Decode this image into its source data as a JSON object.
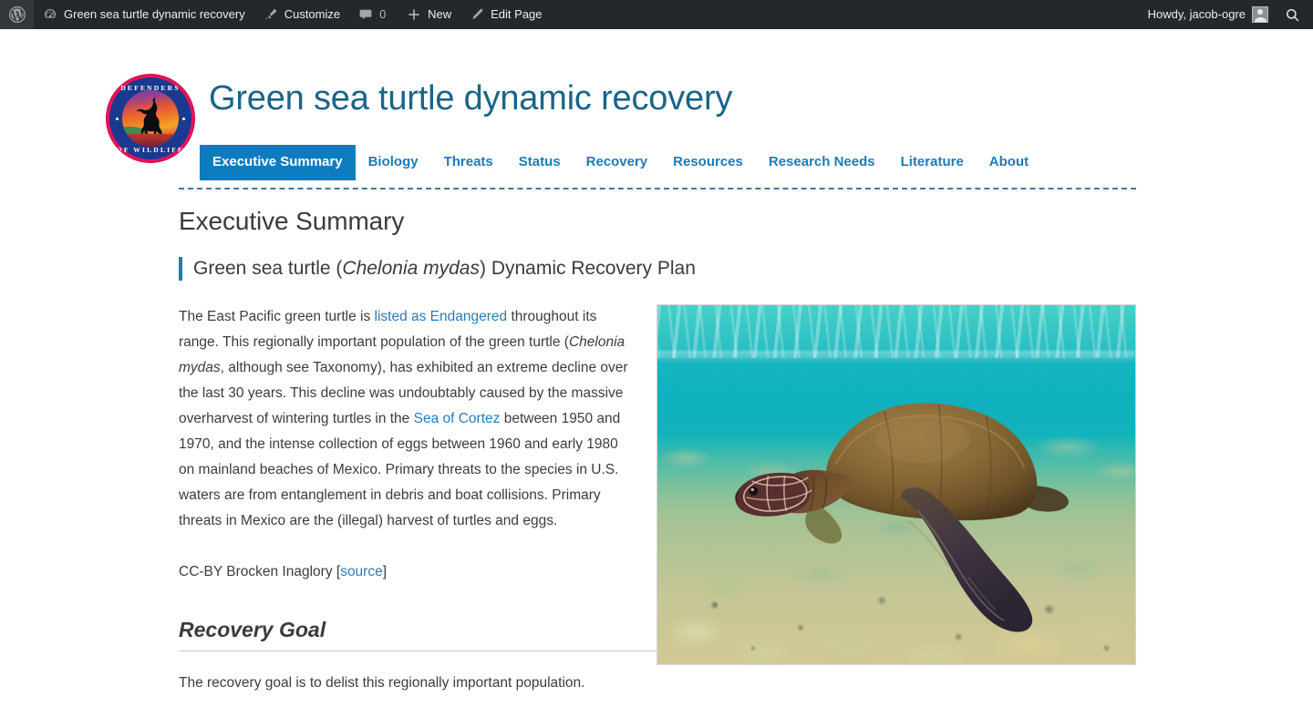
{
  "adminbar": {
    "wp_logo": "wordpress-logo",
    "site_name": "Green sea turtle dynamic recovery",
    "customize": "Customize",
    "comment_count": "0",
    "new": "New",
    "edit_page": "Edit Page",
    "greeting": "Howdy, jacob-ogre",
    "search": "search-icon"
  },
  "header": {
    "logo_text_top": "DEFENDERS",
    "logo_text_bottom": "OF WILDLIFE",
    "site_title": "Green sea turtle dynamic recovery"
  },
  "nav": {
    "items": [
      {
        "label": "Executive Summary",
        "active": true
      },
      {
        "label": "Biology",
        "active": false
      },
      {
        "label": "Threats",
        "active": false
      },
      {
        "label": "Status",
        "active": false
      },
      {
        "label": "Recovery",
        "active": false
      },
      {
        "label": "Resources",
        "active": false
      },
      {
        "label": "Research Needs",
        "active": false
      },
      {
        "label": "Literature",
        "active": false
      },
      {
        "label": "About",
        "active": false
      }
    ]
  },
  "main": {
    "page_title": "Executive Summary",
    "subtitle_pre": "Green sea turtle (",
    "subtitle_species": "Chelonia mydas",
    "subtitle_post": ") Dynamic Recovery Plan",
    "body": {
      "p1_a": "The East Pacific green turtle is ",
      "p1_link1": "listed as Endangered",
      "p1_b": " throughout its range. This regionally important population of the green turtle (",
      "p1_species": "Chelonia mydas",
      "p1_c": ", although see Taxonomy), has exhibited an extreme decline over the last 30 years. This decline was undoubtably caused by the massive overharvest of wintering turtles in the ",
      "p1_link2": "Sea of Cortez",
      "p1_d": " between 1950 and 1970, and the intense collection of eggs between 1960 and early 1980 on mainland beaches of Mexico. Primary threats to the species in U.S. waters are from entanglement in debris and boat collisions. Primary threats in Mexico are the (illegal) harvest of turtles and eggs."
    },
    "credit_pre": "CC-BY Brocken Inaglory [",
    "credit_link": "source",
    "credit_post": "]",
    "figure_alt": "green-sea-turtle-swimming-over-coral-reef"
  },
  "recovery_goal": {
    "title": "Recovery Goal",
    "text": "The recovery goal is to delist this regionally important population."
  },
  "colors": {
    "adminbar_bg": "#23282d",
    "nav_active_bg": "#0c7cbf",
    "link": "#2b7bb9",
    "site_title": "#1a6489",
    "accent_bar": "#1c7cb8"
  }
}
